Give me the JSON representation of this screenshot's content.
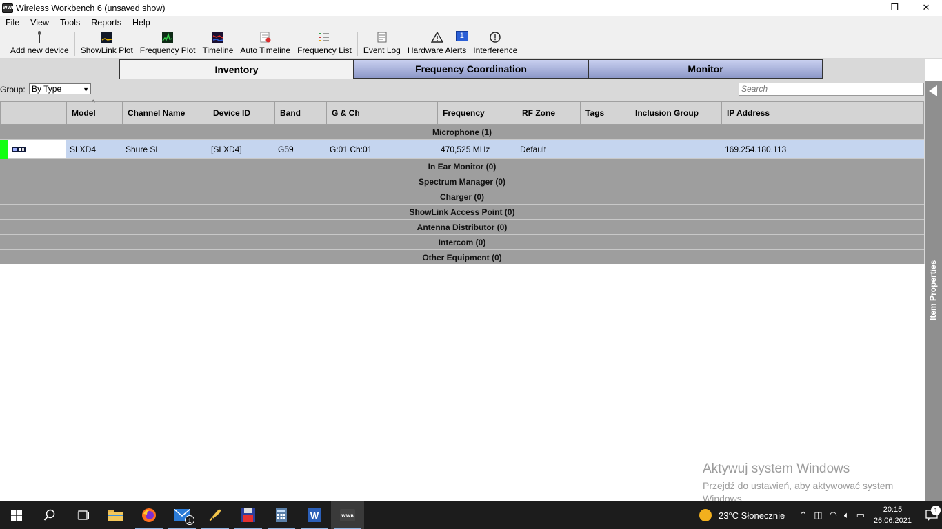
{
  "window": {
    "title": "Wireless Workbench 6 (unsaved show)",
    "app_icon_text": "WWB",
    "minimize": "—",
    "restore": "❐",
    "close": "✕"
  },
  "menu": [
    "File",
    "View",
    "Tools",
    "Reports",
    "Help"
  ],
  "toolbar": {
    "add_device": "Add new device",
    "showlink_plot": "ShowLink Plot",
    "frequency_plot": "Frequency Plot",
    "timeline": "Timeline",
    "auto_timeline": "Auto Timeline",
    "frequency_list": "Frequency List",
    "event_log": "Event Log",
    "hardware_alerts": "Hardware Alerts",
    "hardware_alerts_count": "1",
    "interference": "Interference"
  },
  "tabs": {
    "inventory": "Inventory",
    "frequency_coordination": "Frequency Coordination",
    "monitor": "Monitor"
  },
  "group": {
    "label": "Group:",
    "value": "By Type"
  },
  "search": {
    "placeholder": "Search"
  },
  "table": {
    "sort_indicator": "^",
    "columns": {
      "model": "Model",
      "channel_name": "Channel Name",
      "device_id": "Device ID",
      "band": "Band",
      "g_ch": "G & Ch",
      "frequency": "Frequency",
      "rf_zone": "RF Zone",
      "tags": "Tags",
      "inclusion_group": "Inclusion Group",
      "ip_address": "IP Address"
    },
    "groups": {
      "microphone": "Microphone (1)",
      "in_ear_monitor": "In Ear Monitor (0)",
      "spectrum_manager": "Spectrum Manager (0)",
      "charger": "Charger (0)",
      "showlink_ap": "ShowLink Access Point (0)",
      "antenna_distributor": "Antenna Distributor (0)",
      "intercom": "Intercom (0)",
      "other_equipment": "Other Equipment (0)"
    },
    "row": {
      "model": "SLXD4",
      "channel_name": "Shure SL",
      "device_id": "[SLXD4]",
      "band": "G59",
      "g_ch": "G:01 Ch:01",
      "frequency": "470,525 MHz",
      "rf_zone": "Default",
      "tags": "",
      "inclusion_group": "",
      "ip_address": "169.254.180.113",
      "status_color": "#12ff12"
    }
  },
  "side_panel": {
    "label": "Item Properties"
  },
  "watermark": {
    "title": "Aktywuj system Windows",
    "subtitle": "Przejdź do ustawień, aby aktywować system Windows."
  },
  "taskbar": {
    "weather": "23°C  Słonecznie",
    "time": "20:15",
    "date": "26.06.2021",
    "mail_badge": "1",
    "notif_badge": "1"
  },
  "colors": {
    "tab_active": "#f2f2f2",
    "tab_inactive": "#9aa4d4",
    "row_selected": "#c5d5ef",
    "group_row": "#9e9e9e"
  }
}
